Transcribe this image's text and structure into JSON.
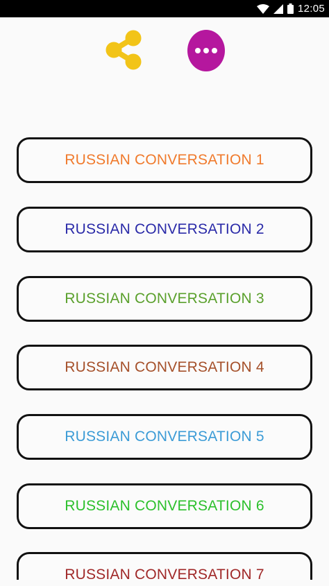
{
  "status_bar": {
    "time": "12:05",
    "icons": [
      "wifi-icon",
      "signal-icon",
      "battery-icon"
    ]
  },
  "toolbar": {
    "share_icon": "share-icon",
    "share_color": "#f2c418",
    "more_icon": "more-options-icon",
    "more_color": "#b5179e"
  },
  "conversations": [
    {
      "label": "RUSSIAN CONVERSATION 1",
      "color": "#f07a2c"
    },
    {
      "label": "RUSSIAN CONVERSATION 2",
      "color": "#2a2aa8"
    },
    {
      "label": "RUSSIAN CONVERSATION 3",
      "color": "#5aa02c"
    },
    {
      "label": "RUSSIAN CONVERSATION 4",
      "color": "#a5502a"
    },
    {
      "label": "RUSSIAN CONVERSATION 5",
      "color": "#3b9bd6"
    },
    {
      "label": "RUSSIAN CONVERSATION 6",
      "color": "#2cc02c"
    },
    {
      "label": "RUSSIAN CONVERSATION 7",
      "color": "#a02828"
    }
  ]
}
